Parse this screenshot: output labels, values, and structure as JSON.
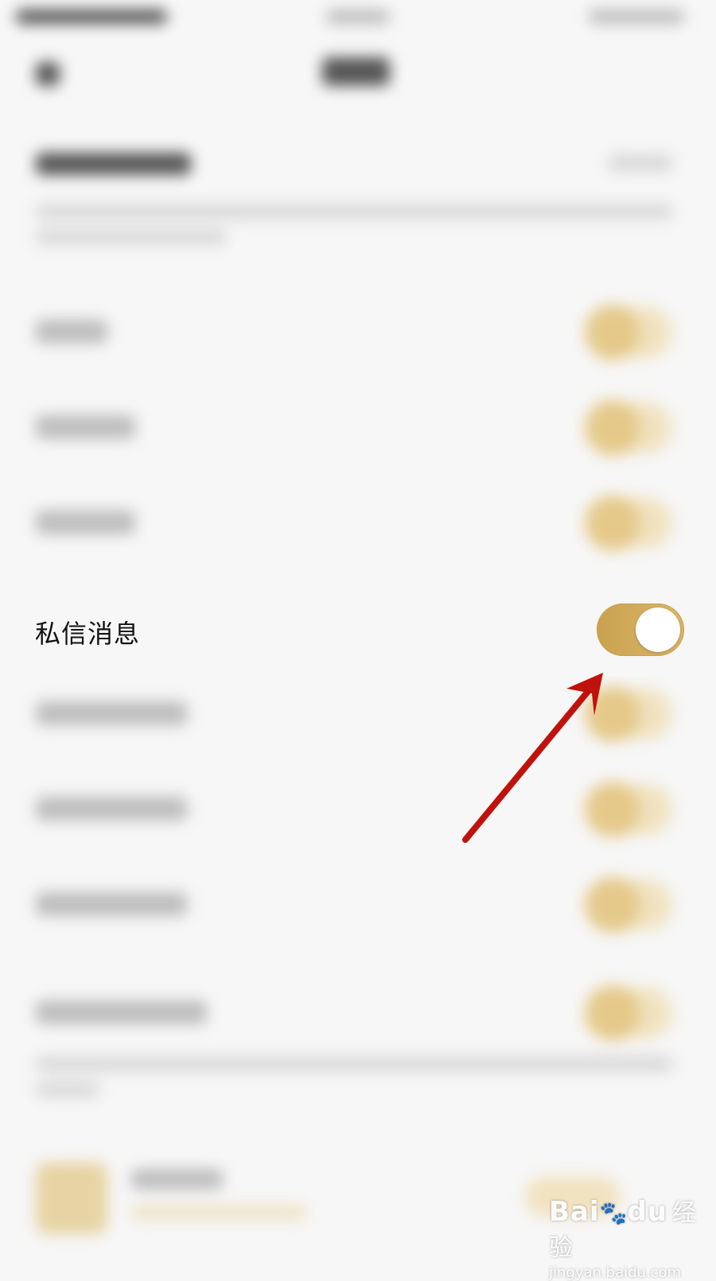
{
  "settings": {
    "private_message_label": "私信消息",
    "private_message_enabled": true
  },
  "colors": {
    "toggle_on": "#d1aa5b",
    "annotation_arrow": "#c0120c"
  },
  "watermark": {
    "logo": "Bai",
    "logo_tail": "du",
    "cn": "经验",
    "url": "jingyan.baidu.com"
  }
}
